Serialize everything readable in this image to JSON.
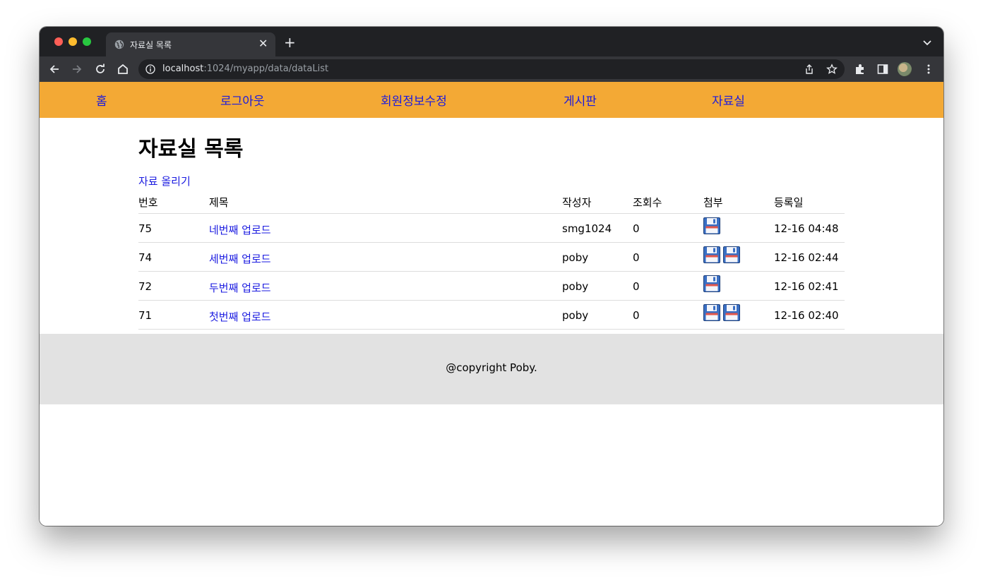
{
  "browser": {
    "tab_title": "자료실 목록",
    "url_host": "localhost",
    "url_path": ":1024/myapp/data/dataList"
  },
  "nav": {
    "items": [
      "홈",
      "로그아웃",
      "회원정보수정",
      "게시판",
      "자료실"
    ],
    "background": "#f3a935",
    "link_color": "#1a1ae0"
  },
  "main": {
    "heading": "자료실 목록",
    "upload_label": "자료 올리기",
    "columns": [
      "번호",
      "제목",
      "작성자",
      "조회수",
      "첨부",
      "등록일"
    ],
    "rows": [
      {
        "num": "75",
        "title": "네번째 업로드",
        "writer": "smg1024",
        "views": "0",
        "attachments": 1,
        "date": "12-16 04:48"
      },
      {
        "num": "74",
        "title": "세번째 업로드",
        "writer": "poby",
        "views": "0",
        "attachments": 2,
        "date": "12-16 02:44"
      },
      {
        "num": "72",
        "title": "두번째 업로드",
        "writer": "poby",
        "views": "0",
        "attachments": 1,
        "date": "12-16 02:41"
      },
      {
        "num": "71",
        "title": "첫번째 업로드",
        "writer": "poby",
        "views": "0",
        "attachments": 2,
        "date": "12-16 02:40"
      }
    ],
    "attachment_icon": "floppy-disk-icon"
  },
  "footer": {
    "text": "@copyright Poby.",
    "background": "#e2e2e2"
  }
}
